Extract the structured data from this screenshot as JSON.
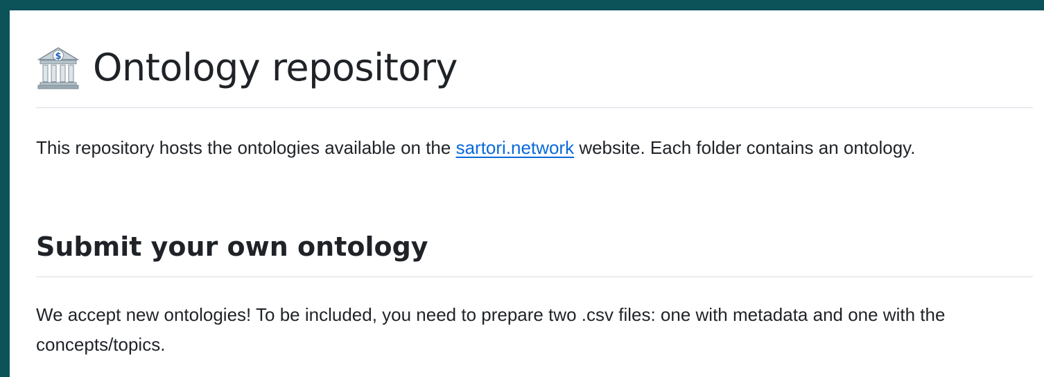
{
  "heading": {
    "icon": "bank-icon",
    "title": "Ontology repository"
  },
  "intro": {
    "before_link": "This repository hosts the ontologies available on the ",
    "link_text": "sartori.network",
    "after_link": " website. Each folder contains an ontology."
  },
  "submit_section": {
    "title": "Submit your own ontology",
    "body": "We accept new ontologies! To be included, you need to prepare two .csv files: one with metadata and one with the concepts/topics."
  },
  "colors": {
    "background_frame": "#0b5259",
    "link": "#0969da",
    "text": "#1f2328",
    "rule": "#d8dee4"
  }
}
